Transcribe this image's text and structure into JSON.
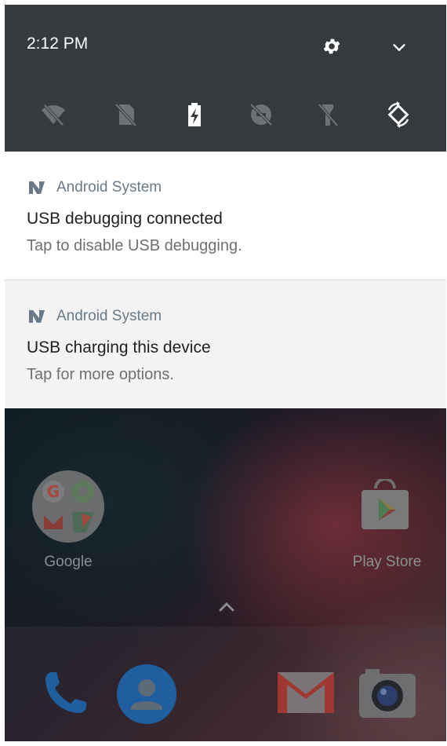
{
  "status": {
    "time": "2:12 PM"
  },
  "quick_settings": {
    "tiles": [
      {
        "name": "wifi-off-icon",
        "active": false
      },
      {
        "name": "no-sim-icon",
        "active": false
      },
      {
        "name": "battery-charging-icon",
        "active": true
      },
      {
        "name": "data-saver-off-icon",
        "active": false
      },
      {
        "name": "flashlight-off-icon",
        "active": false
      },
      {
        "name": "auto-rotate-icon",
        "active": true
      }
    ]
  },
  "notifications": [
    {
      "app": "Android System",
      "title": "USB debugging connected",
      "text": "Tap to disable USB debugging."
    },
    {
      "app": "Android System",
      "title": "USB charging this device",
      "text": "Tap for more options."
    }
  ],
  "home": {
    "apps": [
      {
        "label": "Google"
      },
      {
        "label": "Play Store"
      }
    ],
    "dock": [
      "phone-icon",
      "contacts-icon",
      "gmail-icon",
      "camera-icon"
    ]
  },
  "colors": {
    "qs_background": "#343a3e",
    "notification_app": "#6a7a88"
  }
}
